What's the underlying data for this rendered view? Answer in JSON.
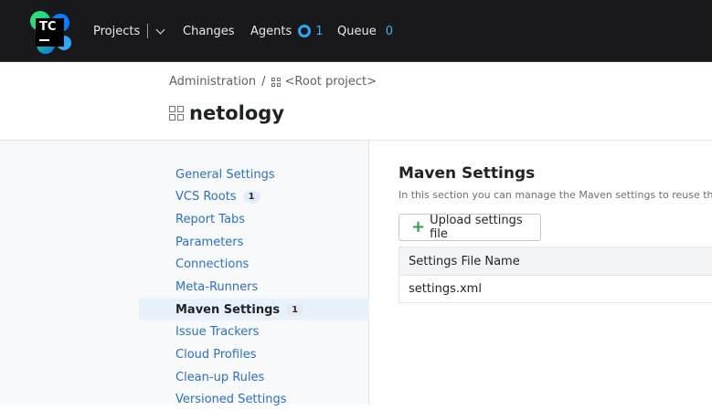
{
  "topbar": {
    "logo_text": "TC",
    "nav": {
      "projects": "Projects",
      "changes": "Changes",
      "agents": "Agents",
      "agents_count": "1",
      "queue": "Queue",
      "queue_count": "0"
    }
  },
  "header": {
    "breadcrumb": {
      "admin": "Administration",
      "separator": "/",
      "root": "<Root project>"
    },
    "title": "netology"
  },
  "sidebar": {
    "items": [
      {
        "label": "General Settings",
        "badge": ""
      },
      {
        "label": "VCS Roots",
        "badge": "1"
      },
      {
        "label": "Report Tabs",
        "badge": ""
      },
      {
        "label": "Parameters",
        "badge": ""
      },
      {
        "label": "Connections",
        "badge": ""
      },
      {
        "label": "Meta-Runners",
        "badge": ""
      },
      {
        "label": "Maven Settings",
        "badge": "1"
      },
      {
        "label": "Issue Trackers",
        "badge": ""
      },
      {
        "label": "Cloud Profiles",
        "badge": ""
      },
      {
        "label": "Clean-up Rules",
        "badge": ""
      },
      {
        "label": "Versioned Settings",
        "badge": ""
      }
    ],
    "active_index": 6
  },
  "main": {
    "title": "Maven Settings",
    "description": "In this section you can manage the Maven settings to reuse them w",
    "upload_button": "Upload settings file",
    "table": {
      "header": "Settings File Name",
      "rows": [
        "settings.xml"
      ]
    }
  },
  "colors": {
    "topbar_bg": "#19191c",
    "link": "#2e6fc4",
    "accent_count": "#4aa8f0",
    "plus_green": "#2f9d4a"
  }
}
